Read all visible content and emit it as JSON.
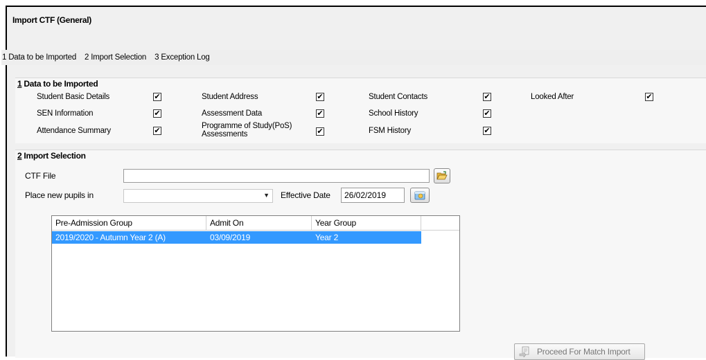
{
  "page": {
    "title": "Import CTF (General)"
  },
  "nav": {
    "links": [
      "1 Data to be Imported",
      "2 Import Selection",
      "3 Exception Log"
    ]
  },
  "data_to_import": {
    "section_number": "1",
    "section_title": " Data to be Imported",
    "options": [
      {
        "label": "Student Basic Details",
        "checked": true
      },
      {
        "label": "Student Address",
        "checked": true
      },
      {
        "label": "Student Contacts",
        "checked": true
      },
      {
        "label": "Looked After",
        "checked": true
      },
      {
        "label": "SEN Information",
        "checked": true
      },
      {
        "label": "Assessment Data",
        "checked": true
      },
      {
        "label": "School History",
        "checked": true
      },
      {
        "label": "Attendance Summary",
        "checked": true
      },
      {
        "label": "Programme of Study(PoS) Assessments",
        "checked": true
      },
      {
        "label": "FSM History",
        "checked": true
      }
    ],
    "check_glyph": "✔"
  },
  "import_selection": {
    "section_number": "2",
    "section_title": " Import Selection",
    "ctf_file_label": "CTF File",
    "ctf_file_value": "",
    "place_label": "Place new pupils in",
    "place_value": "",
    "effective_date_label": "Effective Date",
    "effective_date_value": "26/02/2019",
    "grid": {
      "headers": [
        "Pre-Admission Group",
        "Admit On",
        "Year Group"
      ],
      "rows": [
        {
          "group": "2019/2020 - Autumn Year 2 (A)",
          "admit_on": "03/09/2019",
          "year_group": "Year 2",
          "selected": true
        }
      ]
    },
    "proceed_label": "Proceed For Match Import"
  },
  "icons": {
    "browse": "folder-open-icon",
    "calendar": "calendar-icon",
    "dropdown": "chevron-down-icon",
    "proceed": "import-icon"
  },
  "colors": {
    "selection": "#3399ff",
    "background": "#f0f0f0"
  }
}
